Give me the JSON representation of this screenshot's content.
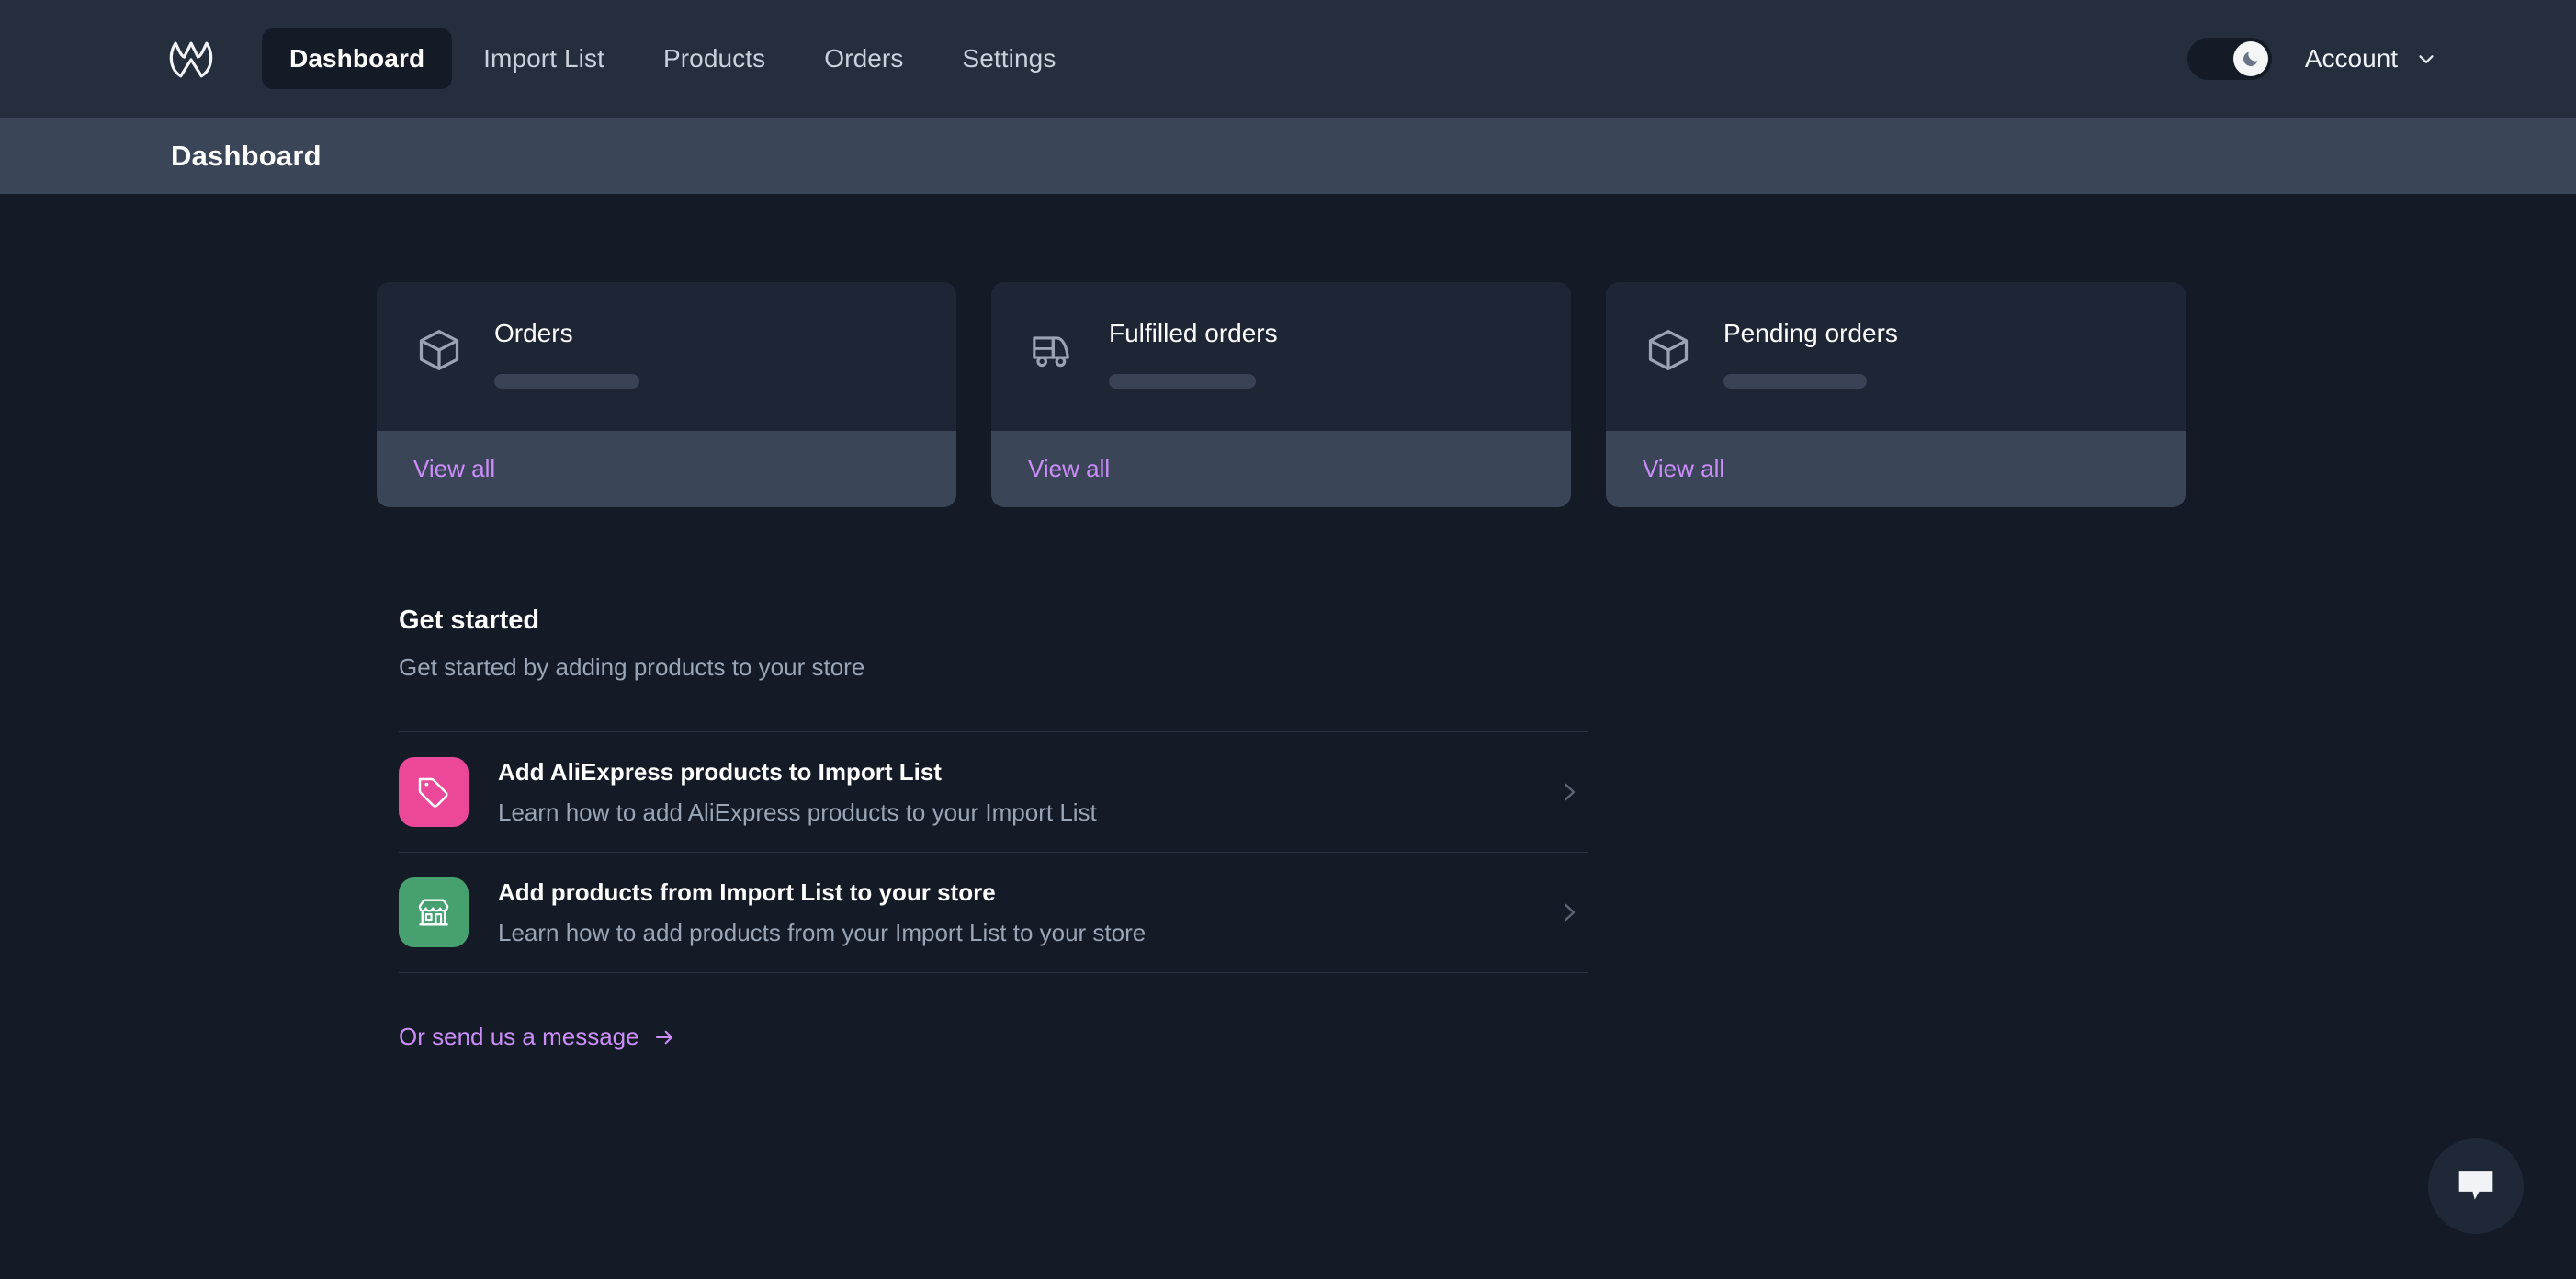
{
  "navbar": {
    "logo_icon": "wayfair-w-logo-icon",
    "links": [
      {
        "label": "Dashboard",
        "active": true
      },
      {
        "label": "Import List",
        "active": false
      },
      {
        "label": "Products",
        "active": false
      },
      {
        "label": "Orders",
        "active": false
      },
      {
        "label": "Settings",
        "active": false
      }
    ],
    "theme_toggle": {
      "icon": "moon-icon",
      "state": "dark",
      "on": true
    },
    "account": {
      "label": "Account",
      "chevron_icon": "chevron-down-icon"
    }
  },
  "page_header": {
    "title": "Dashboard"
  },
  "cards": [
    {
      "title": "Orders",
      "icon": "box-icon",
      "value_loading": true,
      "footer_label": "View all"
    },
    {
      "title": "Fulfilled orders",
      "icon": "truck-icon",
      "value_loading": true,
      "footer_label": "View all"
    },
    {
      "title": "Pending orders",
      "icon": "box-icon",
      "value_loading": true,
      "footer_label": "View all"
    }
  ],
  "get_started": {
    "title": "Get started",
    "subtitle": "Get started by adding products to your store",
    "items": [
      {
        "title": "Add AliExpress products to Import List",
        "description": "Learn how to add AliExpress products to your Import List",
        "icon": "price-tag-icon",
        "icon_color": "#ec4899",
        "chevron_icon": "chevron-right-icon"
      },
      {
        "title": "Add products from Import List to your store",
        "description": "Learn how to add products from your Import List to your store",
        "icon": "storefront-icon",
        "icon_color": "#47a06f",
        "chevron_icon": "chevron-right-icon"
      }
    ],
    "message_link": {
      "label": "Or send us a message",
      "arrow_icon": "arrow-right-icon"
    }
  },
  "chat_widget": {
    "icon": "chat-bubble-icon"
  },
  "colors": {
    "page_background": "#141a26",
    "navbar_background": "#242e3d",
    "page_header_background": "#3a4557",
    "card_background": "#1e2636",
    "card_footer_background": "#3a4557",
    "accent_link": "#cb8ef9",
    "skeleton": "#3a4356",
    "muted_text": "#9aa5b5"
  }
}
